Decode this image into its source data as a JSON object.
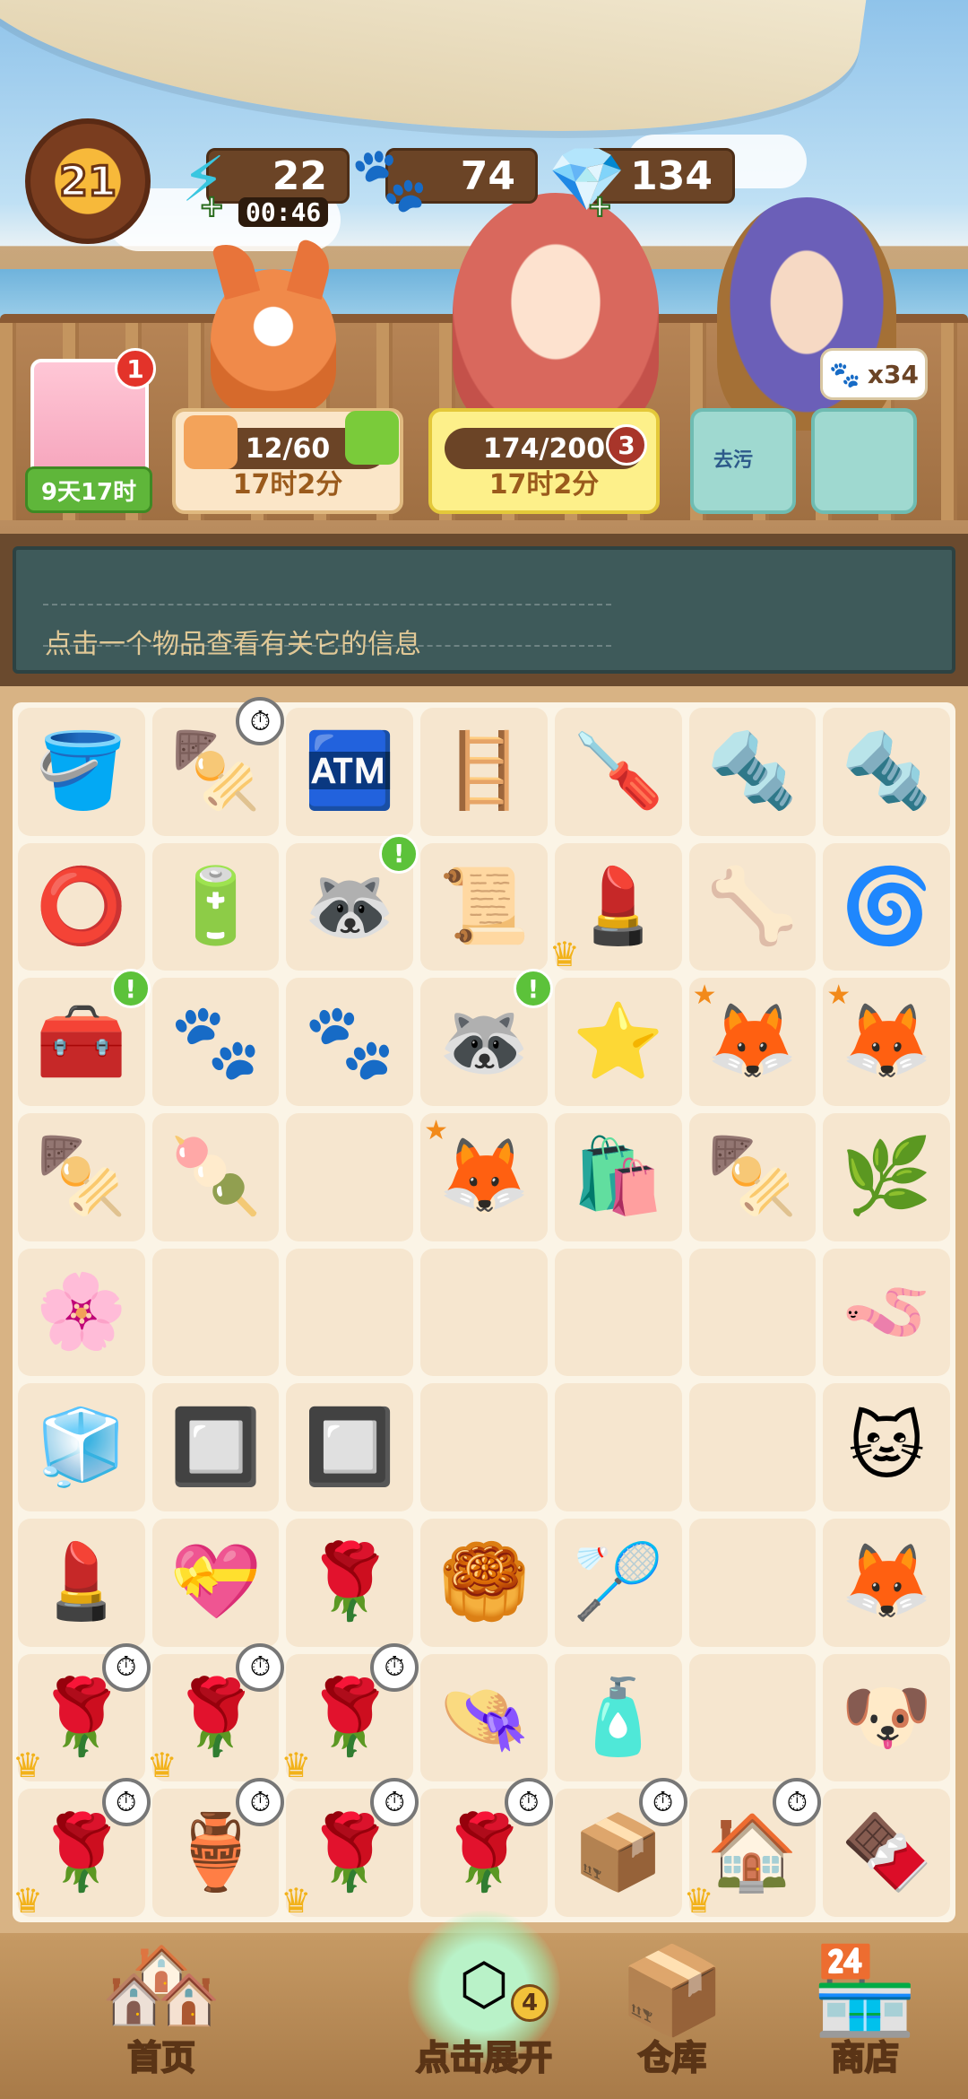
{
  "hud": {
    "level": "21",
    "energy": "22",
    "energy_timer": "00:46",
    "paw_coins": "74",
    "gems": "134"
  },
  "quests": {
    "avatar_time": "9天17时",
    "avatar_badge": "1",
    "card1_progress": "12/60",
    "card1_time": "17时2分",
    "card2_progress": "174/200",
    "card2_badge": "3",
    "card2_time": "17时2分",
    "bubble_count": "x34",
    "item_label": "去污"
  },
  "info": {
    "message": "点击一个物品查看有关它的信息"
  },
  "grid": {
    "rows": [
      [
        {
          "icon": "🪣",
          "name": "wooden-bucket"
        },
        {
          "icon": "🍢",
          "name": "bbq-grill",
          "badge": "clock"
        },
        {
          "icon": "🏧",
          "name": "vending-machine"
        },
        {
          "icon": "🪜",
          "name": "dustpan-stand"
        },
        {
          "icon": "🪛",
          "name": "screwdriver"
        },
        {
          "icon": "🔩",
          "name": "wing-screw"
        },
        {
          "icon": "🔩",
          "name": "bolt"
        }
      ],
      [
        {
          "icon": "⭕",
          "name": "round-badge"
        },
        {
          "icon": "🔋",
          "name": "battery"
        },
        {
          "icon": "🦝",
          "name": "raccoon-lucky",
          "badge": "ex"
        },
        {
          "icon": "📜",
          "name": "paper-scraps"
        },
        {
          "icon": "💄",
          "name": "glue-tube",
          "badge": "crown"
        },
        {
          "icon": "🦴",
          "name": "pipe-pieces"
        },
        {
          "icon": "🌀",
          "name": "spring-toy"
        }
      ],
      [
        {
          "icon": "🧰",
          "name": "purple-chest",
          "badge": "ex"
        },
        {
          "icon": "🐾",
          "name": "paw-coin-pile"
        },
        {
          "icon": "🐾",
          "name": "paw-coin"
        },
        {
          "icon": "🦝",
          "name": "raccoon-scroll",
          "badge": "ex"
        },
        {
          "icon": "⭐",
          "name": "starfish"
        },
        {
          "icon": "🦊",
          "name": "fox-sticker-hat",
          "badge": "star"
        },
        {
          "icon": "🦊",
          "name": "fox-sticker-goggles",
          "badge": "star"
        }
      ],
      [
        {
          "icon": "🍢",
          "name": "skewer-plate"
        },
        {
          "icon": "🍡",
          "name": "mushroom-skewer"
        },
        {
          "icon": "",
          "name": "empty"
        },
        {
          "icon": "🦊",
          "name": "fox-sticker",
          "badge": "star"
        },
        {
          "icon": "🛍️",
          "name": "plastic-bag"
        },
        {
          "icon": "🍢",
          "name": "corn-skewer"
        },
        {
          "icon": "🌿",
          "name": "leaf-bush"
        }
      ],
      [
        {
          "icon": "🌸",
          "name": "petal"
        },
        {
          "icon": "",
          "name": "empty"
        },
        {
          "icon": "",
          "name": "empty"
        },
        {
          "icon": "",
          "name": "empty"
        },
        {
          "icon": "",
          "name": "empty"
        },
        {
          "icon": "",
          "name": "empty"
        },
        {
          "icon": "🪱",
          "name": "rubber-band"
        }
      ],
      [
        {
          "icon": "🧊",
          "name": "glass-shards"
        },
        {
          "icon": "🔲",
          "name": "glass-tray"
        },
        {
          "icon": "🔲",
          "name": "glass-trays"
        },
        {
          "icon": "",
          "name": "empty"
        },
        {
          "icon": "",
          "name": "empty"
        },
        {
          "icon": "",
          "name": "empty"
        },
        {
          "icon": "🐱",
          "name": "cat-keychain"
        }
      ],
      [
        {
          "icon": "💄",
          "name": "lipstick"
        },
        {
          "icon": "💝",
          "name": "rose-heart"
        },
        {
          "icon": "🌹",
          "name": "rose-petals"
        },
        {
          "icon": "🥮",
          "name": "mooncake-box"
        },
        {
          "icon": "🏸",
          "name": "embroidery-hoop"
        },
        {
          "icon": "",
          "name": "empty"
        },
        {
          "icon": "🦊",
          "name": "fox-keychain"
        }
      ],
      [
        {
          "icon": "🌹",
          "name": "rose-pot",
          "badge": "clock-crown"
        },
        {
          "icon": "🌹",
          "name": "rose-pot",
          "badge": "clock-crown"
        },
        {
          "icon": "🌹",
          "name": "rose-pot",
          "badge": "clock-crown"
        },
        {
          "icon": "👒",
          "name": "straw-hat"
        },
        {
          "icon": "🧴",
          "name": "bandage-cup"
        },
        {
          "icon": "",
          "name": "empty"
        },
        {
          "icon": "🐶",
          "name": "dog-keychain"
        }
      ],
      [
        {
          "icon": "🌹",
          "name": "rose-pot",
          "badge": "clock-crown"
        },
        {
          "icon": "🏺",
          "name": "vase",
          "badge": "clock"
        },
        {
          "icon": "🌹",
          "name": "rose-pot",
          "badge": "clock-crown"
        },
        {
          "icon": "🌹",
          "name": "small-rose-pot",
          "badge": "clock"
        },
        {
          "icon": "📦",
          "name": "cardboard-box",
          "badge": "clock"
        },
        {
          "icon": "🏠",
          "name": "cat-house",
          "badge": "clock-crown"
        },
        {
          "icon": "🍫",
          "name": "chocolate-tray"
        }
      ]
    ]
  },
  "nav": {
    "home": "首页",
    "expand": "点击展开",
    "expand_badge": "4",
    "warehouse": "仓库",
    "shop": "商店"
  }
}
